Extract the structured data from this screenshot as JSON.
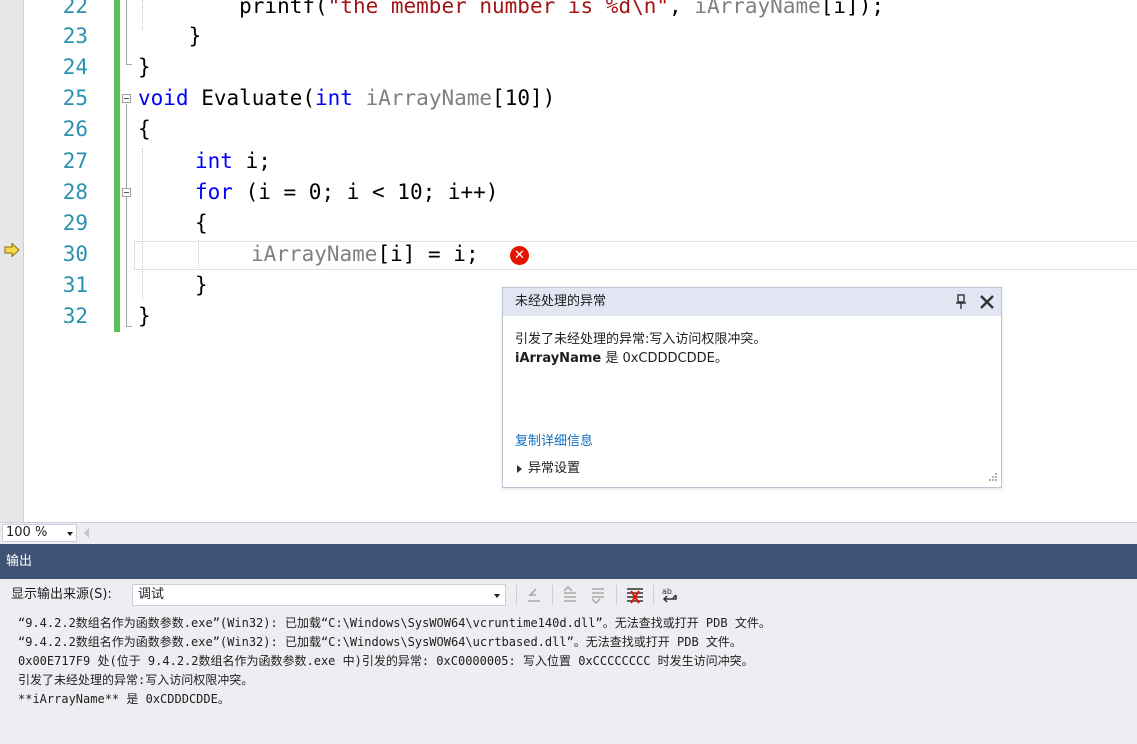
{
  "editor": {
    "line_numbers": [
      "22",
      "23",
      "24",
      "25",
      "26",
      "27",
      "28",
      "29",
      "30",
      "31",
      "32"
    ],
    "code": {
      "l22_pre": "        printf(",
      "l22_str": "\"the member number is %d\\n\"",
      "l22_mid": ", ",
      "l22_param": "iArrayName",
      "l22_post": "[i]);",
      "l23": "    }",
      "l24": "}",
      "l25_kw": "void",
      "l25_name": " Evaluate(",
      "l25_kw2": "int",
      "l25_sp": " ",
      "l25_param": "iArrayName",
      "l25_post": "[10])",
      "l26": "{",
      "l27_kw": "int",
      "l27_post": " i;",
      "l28_kw": "for",
      "l28_post": " (i = 0; i < 10; i++)",
      "l29": "{",
      "l30_param": "iArrayName",
      "l30_post": "[i] = i;",
      "l31": "}",
      "l32": "}"
    },
    "error_glyph": "✕",
    "execution_pointer_icon": "arrow-right-icon"
  },
  "exception_popup": {
    "title": "未经处理的异常",
    "message_line1": "引发了未经处理的异常:写入访问权限冲突。",
    "message_bold": "iArrayName",
    "message_rest": " 是 0xCDDDCDDE。",
    "copy_details": "复制详细信息",
    "exception_settings": "异常设置"
  },
  "status": {
    "zoom": "100 %"
  },
  "output": {
    "title": "输出",
    "source_label": "显示输出来源(S):",
    "source_value": "调试",
    "lines": [
      "“9.4.2.2数组名作为函数参数.exe”(Win32): 已加载“C:\\Windows\\SysWOW64\\vcruntime140d.dll”。无法查找或打开 PDB 文件。",
      "“9.4.2.2数组名作为函数参数.exe”(Win32): 已加载“C:\\Windows\\SysWOW64\\ucrtbased.dll”。无法查找或打开 PDB 文件。",
      "0x00E717F9 处(位于 9.4.2.2数组名作为函数参数.exe 中)引发的异常: 0xC0000005: 写入位置 0xCCCCCCCC 时发生访问冲突。",
      "引发了未经处理的异常:写入访问权限冲突。",
      "**iArrayName** 是 0xCDDDCDDE。"
    ]
  },
  "colors": {
    "keyword": "#0000ff",
    "string": "#a31515",
    "parameter": "#808080",
    "line_number": "#2b91af",
    "change_bar": "#57c257",
    "output_titlebar": "#3f5273",
    "error": "#e51400",
    "link": "#0e70c0"
  }
}
